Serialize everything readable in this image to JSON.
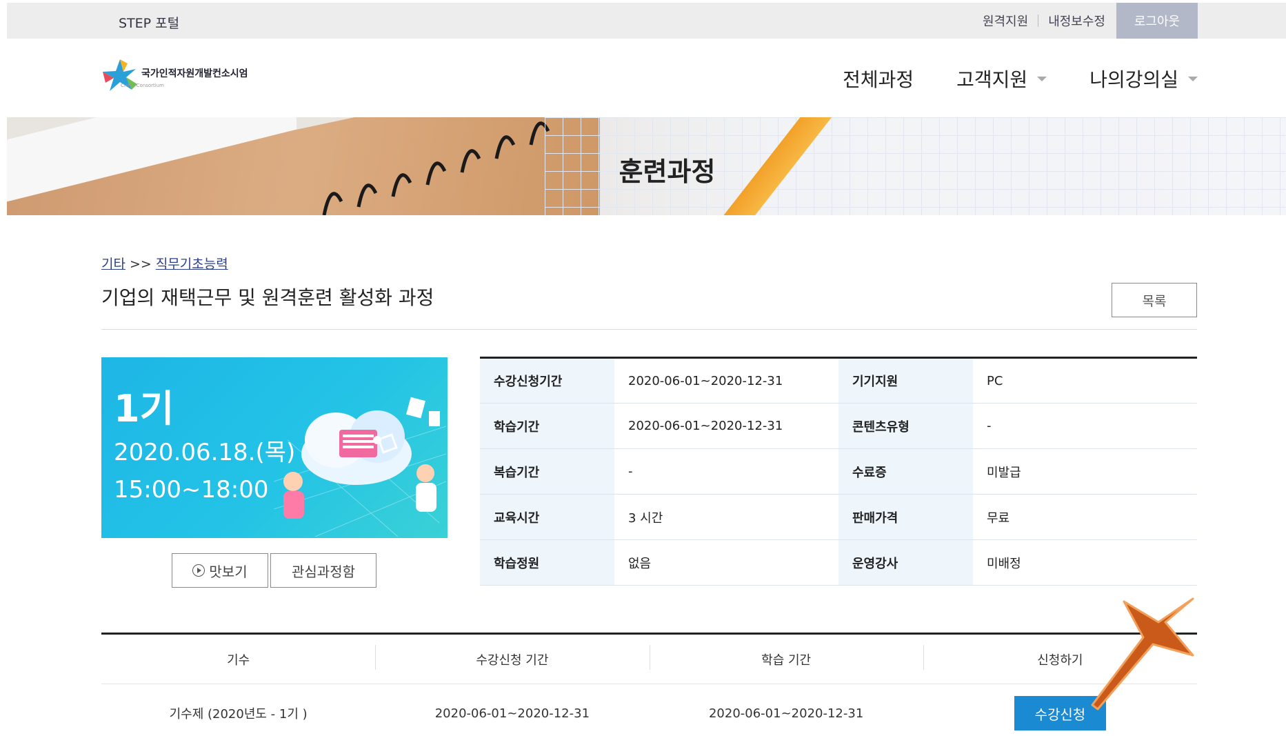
{
  "topbar": {
    "brand": "STEP 포털",
    "links": [
      "원격지원",
      "내정보수정"
    ],
    "logout": "로그아웃"
  },
  "logo": {
    "title": "국가인적자원개발컨소시엄",
    "subtitle": "CHRD Consortium"
  },
  "gnb": {
    "items": [
      "전체과정",
      "고객지원",
      "나의강의실"
    ]
  },
  "hero": {
    "title": "훈련과정"
  },
  "breadcrumb": {
    "level1": "기타",
    "separator": ">>",
    "level2": "직무기초능력"
  },
  "course": {
    "title": "기업의 재택근무 및 원격훈련 활성화 과정",
    "list_button": "목록"
  },
  "thumbnail": {
    "round": "1기",
    "date": "2020.06.18.(목)",
    "time": "15:00~18:00"
  },
  "actions": {
    "preview": "맛보기",
    "interest": "관심과정함"
  },
  "info": [
    {
      "k1": "수강신청기간",
      "v1": "2020-06-01~2020-12-31",
      "k2": "기기지원",
      "v2": "PC"
    },
    {
      "k1": "학습기간",
      "v1": "2020-06-01~2020-12-31",
      "k2": "콘텐츠유형",
      "v2": "-"
    },
    {
      "k1": "복습기간",
      "v1": "-",
      "k2": "수료증",
      "v2": "미발급"
    },
    {
      "k1": "교육시간",
      "v1": "3 시간",
      "k2": "판매가격",
      "v2": "무료"
    },
    {
      "k1": "학습정원",
      "v1": "없음",
      "k2": "운영강사",
      "v2": "미배정"
    }
  ],
  "schedule": {
    "headers": [
      "기수",
      "수강신청 기간",
      "학습 기간",
      "신청하기"
    ],
    "row": {
      "round": "기수제 (2020년도 - 1기 )",
      "apply_period": "2020-06-01~2020-12-31",
      "study_period": "2020-06-01~2020-12-31",
      "apply_button": "수강신청"
    }
  },
  "colors": {
    "accent": "#1a8ad2",
    "arrow": "#c95a1a",
    "thumb": "#1eb6e6"
  }
}
